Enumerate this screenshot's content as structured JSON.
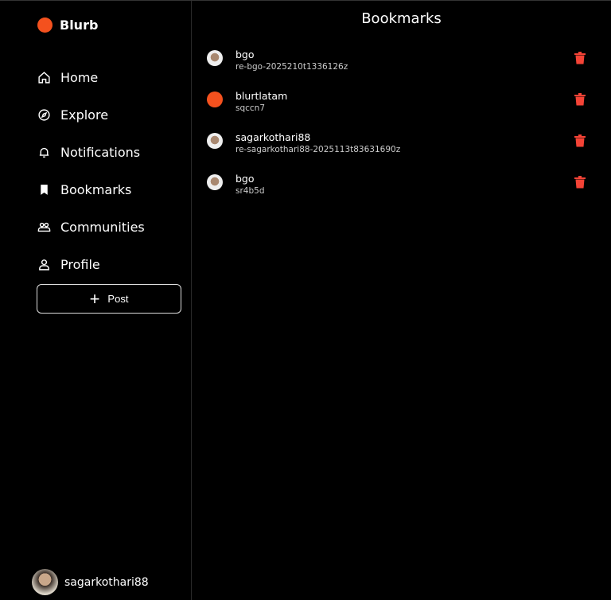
{
  "app": {
    "name": "Blurb"
  },
  "nav": [
    {
      "label": "Home",
      "icon": "home-icon"
    },
    {
      "label": "Explore",
      "icon": "compass-icon"
    },
    {
      "label": "Notifications",
      "icon": "bell-icon"
    },
    {
      "label": "Bookmarks",
      "icon": "bookmark-icon"
    },
    {
      "label": "Communities",
      "icon": "people-icon"
    },
    {
      "label": "Profile",
      "icon": "person-icon"
    }
  ],
  "post_label": "Post",
  "user": {
    "name": "sagarkothari88"
  },
  "main": {
    "title": "Bookmarks"
  },
  "bookmarks": [
    {
      "author": "bgo",
      "permlink": "re-bgo-2025210t1336126z"
    },
    {
      "author": "blurtlatam",
      "permlink": "sqccn7"
    },
    {
      "author": "sagarkothari88",
      "permlink": "re-sagarkothari88-2025113t83631690z"
    },
    {
      "author": "bgo",
      "permlink": "sr4b5d"
    }
  ],
  "colors": {
    "delete": "#f44336",
    "logo": "#f4511e"
  }
}
